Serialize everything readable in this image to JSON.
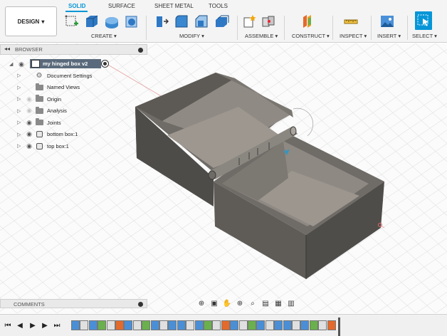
{
  "toolbar": {
    "workspace_button": "DESIGN",
    "tabs": [
      "SOLID",
      "SURFACE",
      "SHEET METAL",
      "TOOLS"
    ],
    "groups": {
      "create": "CREATE",
      "modify": "MODIFY",
      "assemble": "ASSEMBLE",
      "construct": "CONSTRUCT",
      "inspect": "INSPECT",
      "insert": "INSERT",
      "select": "SELECT"
    }
  },
  "browser": {
    "title": "BROWSER",
    "root": "my hinged box v2",
    "items": [
      {
        "label": "Document Settings",
        "icon": "gear-icon",
        "eye": false
      },
      {
        "label": "Named Views",
        "icon": "folder-icon",
        "eye": false
      },
      {
        "label": "Origin",
        "icon": "folder-icon",
        "eye": "dim"
      },
      {
        "label": "Analysis",
        "icon": "folder-icon",
        "eye": "dim"
      },
      {
        "label": "Joints",
        "icon": "folder-icon",
        "eye": true
      },
      {
        "label": "bottom box:1",
        "icon": "body-icon",
        "eye": true
      },
      {
        "label": "top box:1",
        "icon": "body-icon",
        "eye": true
      }
    ]
  },
  "comments": {
    "title": "COMMENTS"
  },
  "colors": {
    "accent": "#0696d7",
    "model": "#6f6b65",
    "grid": "#dcdcdc"
  }
}
